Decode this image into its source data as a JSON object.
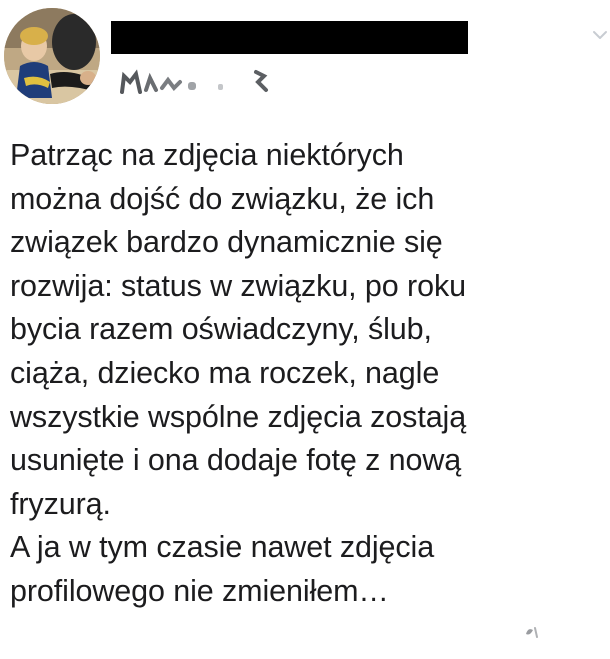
{
  "post": {
    "lines": [
      "Patrząc na zdjęcia niektórych",
      "można dojść do związku, że ich",
      "związek bardzo dynamicznie się",
      "rozwija: status w związku, po roku",
      "bycia razem oświadczyny, ślub,",
      "ciąża, dziecko ma roczek, nagle",
      "wszystkie wspólne zdjęcia zostają",
      "usunięte i ona dodaje fotę z nową",
      "fryzurą.",
      "A ja w tym czasie nawet zdjęcia",
      "profilowego nie zmieniłem…"
    ]
  },
  "icons": {
    "menu": "chevron-down-icon",
    "avatar": "avatar"
  },
  "colors": {
    "text": "#1c1c1e",
    "redaction": "#000000",
    "chevron": "#c8ccd2",
    "background": "#ffffff"
  }
}
